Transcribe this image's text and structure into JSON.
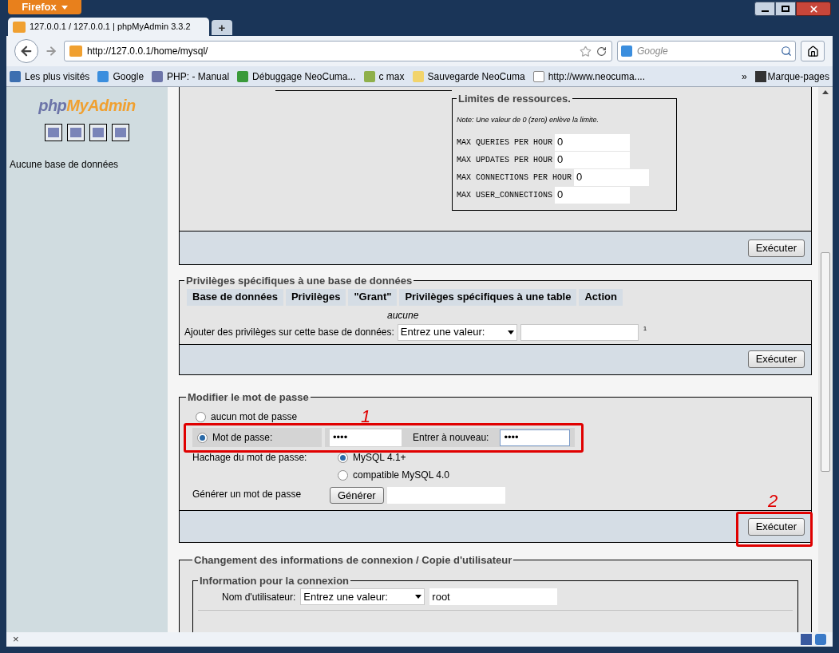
{
  "browser": {
    "menu_button": "Firefox",
    "tabs": [
      {
        "title": "127.0.0.1 / 127.0.0.1 | phpMyAdmin 3.3.2",
        "selected": true
      }
    ],
    "new_tab": "+",
    "url": "http://127.0.0.1/home/mysql/",
    "search_placeholder": "Google",
    "bookmarks": [
      {
        "label": "Les plus visités",
        "kind": "magnifier"
      },
      {
        "label": "Google",
        "kind": "google"
      },
      {
        "label": "PHP: - Manual",
        "kind": "php"
      },
      {
        "label": "Débuggage NeoCuma...",
        "kind": "sheet"
      },
      {
        "label": "c max",
        "kind": "image"
      },
      {
        "label": "Sauvegarde NeoCuma",
        "kind": "folder"
      },
      {
        "label": "http://www.neocuma....",
        "kind": "page"
      }
    ],
    "more": "»",
    "bookmarks_menu": "Marque-pages",
    "status_close": "×"
  },
  "sidebar": {
    "logo": {
      "part_1": "php",
      "part_2": "MyAdmin"
    },
    "empty_text": "Aucune base de données"
  },
  "resource_limits": {
    "legend": "Limites de ressources.",
    "note": "Note: Une valeur de 0 (zero) enlève la limite.",
    "fields": [
      {
        "label": "MAX QUERIES PER HOUR",
        "value": "0"
      },
      {
        "label": "MAX UPDATES PER HOUR",
        "value": "0"
      },
      {
        "label": "MAX CONNECTIONS PER HOUR",
        "value": "0"
      },
      {
        "label": "MAX USER_CONNECTIONS",
        "value": "0"
      }
    ],
    "submit": "Exécuter"
  },
  "db_privileges": {
    "legend": "Privilèges spécifiques à une base de données",
    "columns": [
      "Base de données",
      "Privilèges",
      "\"Grant\"",
      "Privilèges spécifiques à une table",
      "Action"
    ],
    "empty": "aucune",
    "add_label": "Ajouter des privilèges sur cette base de données:",
    "select": "Entrez une valeur:",
    "footnote": "1",
    "submit": "Exécuter"
  },
  "change_password": {
    "legend": "Modifier le mot de passe",
    "options": [
      {
        "label": "aucun mot de passe",
        "selected": false
      },
      {
        "label": "Mot de passe:",
        "selected": true
      }
    ],
    "password": "••••",
    "retype_label": "Entrer à nouveau:",
    "retype": "••••",
    "hashing_label": "Hachage du mot de passe:",
    "hashing": [
      {
        "label": "MySQL 4.1+",
        "selected": true
      },
      {
        "label": "compatible MySQL 4.0",
        "selected": false
      }
    ],
    "generate_label": "Générer un mot de passe",
    "generate_button": "Générer",
    "submit": "Exécuter"
  },
  "annotations": [
    {
      "label": "1"
    },
    {
      "label": "2"
    }
  ],
  "login_change": {
    "legend": "Changement des informations de connexion / Copie d'utilisateur",
    "sub_legend": "Information pour la connexion",
    "user_label": "Nom d'utilisateur:",
    "user_select": "Entrez une valeur:",
    "user_value": "root"
  }
}
